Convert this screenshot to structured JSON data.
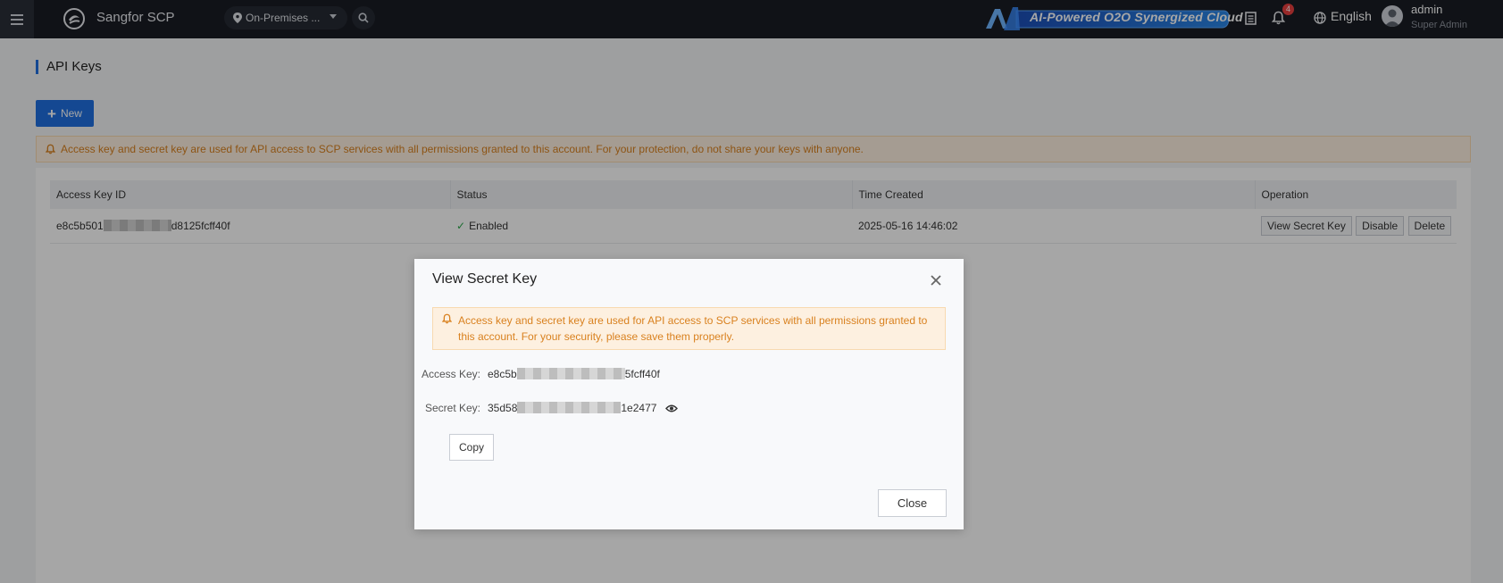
{
  "topbar": {
    "brand": "Sangfor SCP",
    "region": "On-Premises ...",
    "banner": "AI-Powered O2O Synergized Cloud",
    "notifications": "4",
    "language": "English",
    "user": {
      "name": "admin",
      "role": "Super Admin"
    }
  },
  "page": {
    "title": "API Keys",
    "new_label": "New",
    "alert": "Access key and secret key are used for API access to SCP services with all permissions granted to this account. For your protection, do not share your keys with anyone."
  },
  "table": {
    "columns": [
      "Access Key ID",
      "Status",
      "Time Created",
      "Operation"
    ],
    "rows": [
      {
        "key_prefix": "e8c5b501",
        "key_suffix": "d8125fcff40f",
        "status": "Enabled",
        "created": "2025-05-16 14:46:02",
        "ops": [
          "View Secret Key",
          "Disable",
          "Delete"
        ]
      }
    ]
  },
  "modal": {
    "title": "View Secret Key",
    "alert": "Access key and secret key are used for API access to SCP services with all permissions granted to this account. For your security, please save them properly.",
    "access_key_label": "Access Key:",
    "access_key_prefix": "e8c5b",
    "access_key_suffix": "5fcff40f",
    "secret_key_label": "Secret Key:",
    "secret_key_prefix": "35d58",
    "secret_key_suffix": "1e2477",
    "copy_label": "Copy",
    "close_label": "Close"
  },
  "colors": {
    "primary": "#1f6fe0",
    "topbar": "#191c24",
    "warning_text": "#d9811f",
    "warning_bg": "#fdf0e0",
    "success": "#2ba84a",
    "badge": "#e84040"
  }
}
